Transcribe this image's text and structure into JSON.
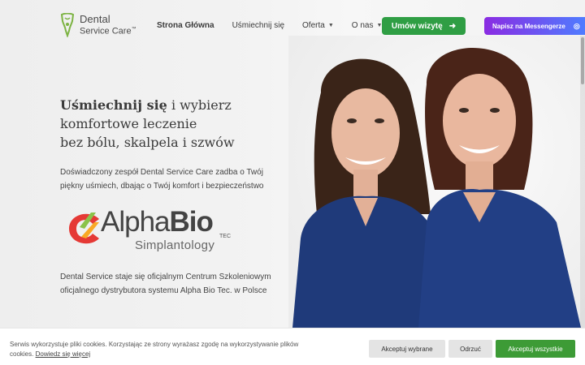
{
  "header": {
    "logo": {
      "line1": "Dental",
      "line2": "Service Care",
      "tm": "™"
    },
    "nav": [
      {
        "label": "Strona Główna",
        "active": true,
        "dropdown": false
      },
      {
        "label": "Uśmiechnij się",
        "active": false,
        "dropdown": false
      },
      {
        "label": "Oferta",
        "active": false,
        "dropdown": true
      },
      {
        "label": "O nas",
        "active": false,
        "dropdown": true
      }
    ],
    "book_button": "Umów wizytę",
    "messenger_button": "Napisz na Messengerze"
  },
  "hero": {
    "headline_bold": "Uśmiechnij się",
    "headline_rest1": " i wybierz",
    "headline_line2": "komfortowe leczenie",
    "headline_line3": "bez bólu, skalpela i szwów",
    "subtext_line1": "Doświadczony zespół Dental Service Care zadba o Twój",
    "subtext_line2": "piękny uśmiech, dbając o Twój komfort i bezpieczeństwo",
    "brand_main_a": "Alpha",
    "brand_main_b": "Bio",
    "brand_tec": "TEC",
    "brand_sub": "Simplantology",
    "info_line1": "Dental Service staje się oficjalnym Centrum Szkoleniowym",
    "info_line2": "oficjalnego dystrybutora systemu Alpha Bio Tec. w Polsce"
  },
  "cookie": {
    "text": "Serwis wykorzystuje pliki cookies. Korzystając ze strony wyrażasz zgodę na wykorzystywanie plików cookies.",
    "link": "Dowiedz się więcej",
    "accept_selected": "Akceptuj wybrane",
    "reject": "Odrzuć",
    "accept_all": "Akceptuj wszystkie"
  },
  "colors": {
    "primary_green": "#2f9e44",
    "accept_green": "#3d9b36",
    "messenger_gradient_start": "#8a2be2",
    "messenger_gradient_end": "#4f7cff",
    "scrub_blue": "#1f3a7a"
  }
}
